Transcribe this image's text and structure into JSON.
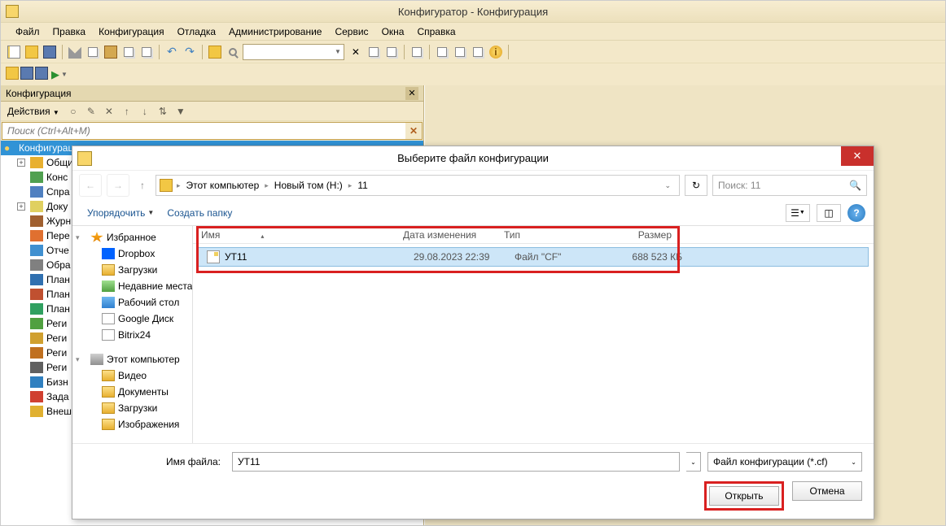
{
  "app": {
    "title": "Конфигуратор - Конфигурация"
  },
  "menu": {
    "items": [
      "Файл",
      "Правка",
      "Конфигурация",
      "Отладка",
      "Администрирование",
      "Сервис",
      "Окна",
      "Справка"
    ]
  },
  "config_panel": {
    "title": "Конфигурация",
    "actions_label": "Действия",
    "search_placeholder": "Поиск (Ctrl+Alt+M)",
    "root": "Конфигурация",
    "tree": [
      {
        "label": "Общи",
        "exp": "+"
      },
      {
        "label": "Конс"
      },
      {
        "label": "Спра"
      },
      {
        "label": "Доку",
        "exp": "+"
      },
      {
        "label": "Журн"
      },
      {
        "label": "Пере"
      },
      {
        "label": "Отче"
      },
      {
        "label": "Обра"
      },
      {
        "label": "План"
      },
      {
        "label": "План"
      },
      {
        "label": "План"
      },
      {
        "label": "Реги"
      },
      {
        "label": "Реги"
      },
      {
        "label": "Реги"
      },
      {
        "label": "Реги"
      },
      {
        "label": "Бизн"
      },
      {
        "label": "Зада"
      },
      {
        "label": "Внеш"
      }
    ]
  },
  "dialog": {
    "title": "Выберите файл конфигурации",
    "breadcrumb": [
      "Этот компьютер",
      "Новый том (H:)",
      "11"
    ],
    "search_placeholder": "Поиск: 11",
    "organize": "Упорядочить",
    "new_folder": "Создать папку",
    "side_groups": [
      {
        "label": "Избранное",
        "icon": "ico-star",
        "items": [
          {
            "label": "Dropbox",
            "icon": "ico-dropbox"
          },
          {
            "label": "Загрузки",
            "icon": "ico-folder"
          },
          {
            "label": "Недавние места",
            "icon": "ico-recent"
          },
          {
            "label": "Рабочий стол",
            "icon": "ico-desktop"
          },
          {
            "label": "Google Диск",
            "icon": "ico-doc"
          },
          {
            "label": "Bitrix24",
            "icon": "ico-doc"
          }
        ]
      },
      {
        "label": "Этот компьютер",
        "icon": "ico-pc",
        "items": [
          {
            "label": "Видео",
            "icon": "ico-folder"
          },
          {
            "label": "Документы",
            "icon": "ico-folder"
          },
          {
            "label": "Загрузки",
            "icon": "ico-folder"
          },
          {
            "label": "Изображения",
            "icon": "ico-folder"
          }
        ]
      }
    ],
    "columns": {
      "name": "Имя",
      "date": "Дата изменения",
      "type": "Тип",
      "size": "Размер"
    },
    "file": {
      "name": "УТ11",
      "date": "29.08.2023 22:39",
      "type": "Файл \"CF\"",
      "size": "688 523 КБ"
    },
    "filename_label": "Имя файла:",
    "filename_value": "УТ11",
    "filetype": "Файл конфигурации (*.cf)",
    "open": "Открыть",
    "cancel": "Отмена"
  }
}
